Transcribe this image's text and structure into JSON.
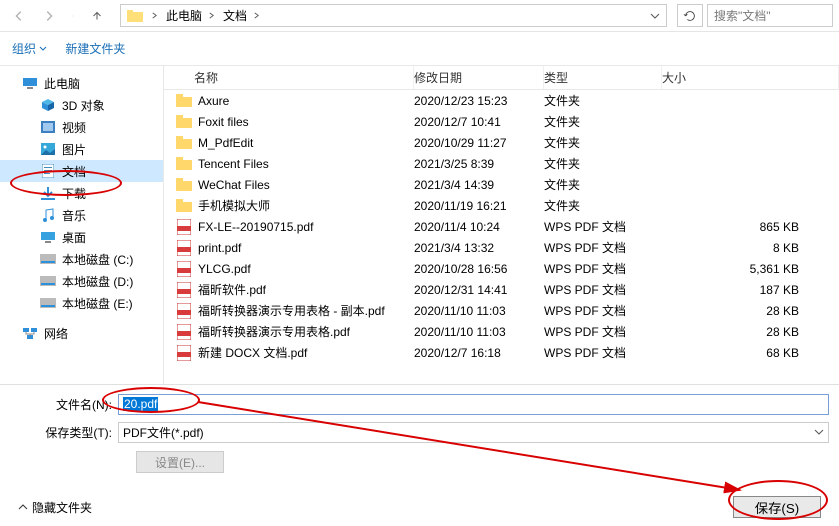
{
  "nav": {
    "path_root": "此电脑",
    "path_folder": "文档",
    "search_placeholder": "搜索\"文档\""
  },
  "toolbar": {
    "organize": "组织",
    "new_folder": "新建文件夹"
  },
  "tree": {
    "this_pc": "此电脑",
    "objects_3d": "3D 对象",
    "videos": "视频",
    "pictures": "图片",
    "documents": "文档",
    "downloads": "下载",
    "music": "音乐",
    "desktop": "桌面",
    "disk_c": "本地磁盘 (C:)",
    "disk_d": "本地磁盘 (D:)",
    "disk_e": "本地磁盘 (E:)",
    "network": "网络"
  },
  "cols": {
    "name": "名称",
    "date": "修改日期",
    "type": "类型",
    "size": "大小"
  },
  "rows": [
    {
      "icon": "folder",
      "name": "Axure",
      "date": "2020/12/23 15:23",
      "type": "文件夹",
      "size": ""
    },
    {
      "icon": "folder",
      "name": "Foxit files",
      "date": "2020/12/7 10:41",
      "type": "文件夹",
      "size": ""
    },
    {
      "icon": "folder",
      "name": "M_PdfEdit",
      "date": "2020/10/29 11:27",
      "type": "文件夹",
      "size": ""
    },
    {
      "icon": "folder",
      "name": "Tencent Files",
      "date": "2021/3/25 8:39",
      "type": "文件夹",
      "size": ""
    },
    {
      "icon": "folder",
      "name": "WeChat Files",
      "date": "2021/3/4 14:39",
      "type": "文件夹",
      "size": ""
    },
    {
      "icon": "folder",
      "name": "手机模拟大师",
      "date": "2020/11/19 16:21",
      "type": "文件夹",
      "size": ""
    },
    {
      "icon": "pdf",
      "name": "FX-LE--20190715.pdf",
      "date": "2020/11/4 10:24",
      "type": "WPS PDF 文档",
      "size": "865 KB"
    },
    {
      "icon": "pdf",
      "name": "print.pdf",
      "date": "2021/3/4 13:32",
      "type": "WPS PDF 文档",
      "size": "8 KB"
    },
    {
      "icon": "pdf",
      "name": "YLCG.pdf",
      "date": "2020/10/28 16:56",
      "type": "WPS PDF 文档",
      "size": "5,361 KB"
    },
    {
      "icon": "pdf",
      "name": "福昕软件.pdf",
      "date": "2020/12/31 14:41",
      "type": "WPS PDF 文档",
      "size": "187 KB"
    },
    {
      "icon": "pdf",
      "name": "福昕转换器演示专用表格 - 副本.pdf",
      "date": "2020/11/10 11:03",
      "type": "WPS PDF 文档",
      "size": "28 KB"
    },
    {
      "icon": "pdf",
      "name": "福昕转换器演示专用表格.pdf",
      "date": "2020/11/10 11:03",
      "type": "WPS PDF 文档",
      "size": "28 KB"
    },
    {
      "icon": "pdf",
      "name": "新建 DOCX 文档.pdf",
      "date": "2020/12/7 16:18",
      "type": "WPS PDF 文档",
      "size": "68 KB"
    }
  ],
  "save": {
    "name_label": "文件名(N):",
    "name_value": "20.pdf",
    "type_label": "保存类型(T):",
    "type_value": "PDF文件(*.pdf)",
    "settings_btn": "设置(E)...",
    "hide_files": "隐藏文件夹",
    "save_btn": "保存(S)"
  }
}
